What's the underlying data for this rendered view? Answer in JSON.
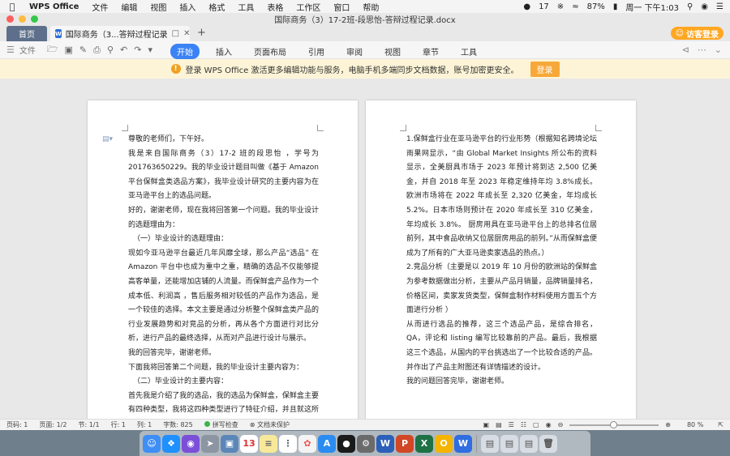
{
  "menubar": {
    "app_name": "WPS Office",
    "items": [
      "文件",
      "编辑",
      "视图",
      "插入",
      "格式",
      "工具",
      "表格",
      "工作区",
      "窗口",
      "帮助"
    ],
    "notification_count": "17",
    "battery": "87%",
    "clock": "周一 下午1:03"
  },
  "window": {
    "title": "国际商务（3）17-2班-段思怡-答辩过程记录.docx"
  },
  "tabs": {
    "home_label": "首页",
    "doc_tab_label": "国际商务（3...答辩过程记录",
    "add_label": "+",
    "guest_login_label": "访客登录"
  },
  "toolbar": {
    "file_label": "文件",
    "ribbon_tabs": [
      "开始",
      "插入",
      "页面布局",
      "引用",
      "审阅",
      "视图",
      "章节",
      "工具"
    ],
    "active_tab": "开始"
  },
  "notice": {
    "text": "登录 WPS Office 激活更多编辑功能与服务，电脑手机多端同步文档数据，账号加密更安全。",
    "button_label": "登录"
  },
  "page1": {
    "paragraphs": [
      "尊敬的老师们，下午好。",
      "我是来自国际商务（3）17-2 班的段思怡 ，学号为 201763650229。我的毕业设计题目叫做《基于 Amazon 平台保鲜盒类选品方案》，我毕业设计研究的主要内容为在亚马逊平台上的选品问题。",
      "好的，谢谢老师，现在我将回答第一个问题。我的毕业设计的选题理由为：",
      "（一）毕业设计的选题理由：",
      "现如今亚马逊平台最近几年风靡全球，那么产品“选品” 在 Amazon 平台中也成为重中之重，精确的选品不仅能够提高客单量，还能增加店铺的人流量。而保鲜盒产品作为一个 成本低、利润高 ，售后服务相对较低的产品作为选品，是一个较佳的选择。本文主要是通过分析整个保鲜盒类产品的行业发展趋势和对竞品的分析，再从各个方面进行对比分析，进行产品的最终选择，从而对产品进行设计与展示。",
      "我的回答完毕，谢谢老师。",
      "下面我将回答第二个问题，我的毕业设计主要内容为：",
      "（二）毕业设计的主要内容：",
      "首先我是介绍了我的选品，我的选品为保鲜盒，保鲜盒主要有四种类型，我将这四种类型进行了特征介绍，并且就这所以保鲜盒行业现状进行了调查。然后从两个方面分析了我"
    ]
  },
  "page2": {
    "paragraphs": [
      "1.保鲜盒行业在亚马逊平台的行业形势（根据知名跨境论坛雨果网显示，“由 Global Market Insights 所公布的资料显示，全美厨具市场于 2023 年预计将到达 2,500 亿美金，并自 2018 年至 2023 年稳定维持年均 3.8%成长。欧洲市场将在 2022 年成长至 2,320 亿美金，年均成长 5.2%。日本市场则预计在 2020 年成长至 310 亿美金，年均成长 3.8%。 厨房用具在亚马逊平台上的总排名位居前列，其中食品收纳又位居厨房用品的前列。”从而保鲜盒便成为了所有的广大亚马逊卖家选品的热点。）",
      "2.竞品分析（主要是以 2019 年 10 月份的欧洲站的保鲜盒为参考数据做出分析，主要从产品月销量，品牌销量排名，价格区间，卖家发货类型，保鲜盒制作材料使用方面五个方面进行分析 ）",
      "从而进行选品的推荐，这三个选品产品，是综合排名，QA，评论和 listing 编写比较靠前的产品。最后，我根据这三个选品，从国内的平台挑选出了一个比较合适的产品。并作出了产品主附图还有详情描述的设计。",
      "我的问题回答完毕，谢谢老师。"
    ]
  },
  "statusbar": {
    "page_num": "页码: 1",
    "page_count": "页面: 1/2",
    "section": "节: 1/1",
    "line": "行: 1",
    "column": "列: 1",
    "word_count": "字数: 825",
    "spellcheck": "拼写检查",
    "doc_protect": "文档未保护",
    "zoom": "80 %",
    "zoom_level": 0.45
  },
  "dock": {
    "icons": [
      "finder-icon",
      "safari-icon",
      "siri-icon",
      "launchpad-icon",
      "preview-icon",
      "calendar-icon",
      "notes-icon",
      "reminders-icon",
      "photos-icon",
      "appstore-icon",
      "qq-icon",
      "settings-icon",
      "word-icon",
      "powerpoint-icon",
      "excel-icon",
      "unknown-app-icon",
      "wps-icon",
      "downloads-icon",
      "stack-icon",
      "screenshot-icon",
      "trash-icon"
    ]
  }
}
